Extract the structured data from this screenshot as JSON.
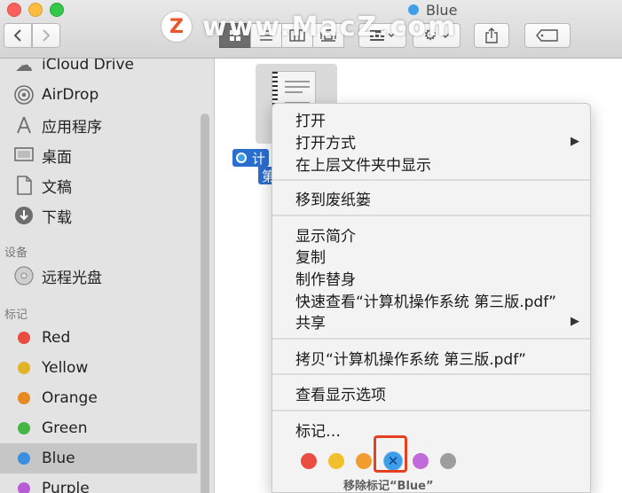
{
  "window": {
    "title": "Blue",
    "title_tag_color": "#3fa0ea"
  },
  "watermark": {
    "logo_letter": "Z",
    "text": "www.MacZ.com"
  },
  "toolbar": {
    "back_icon": "chevron-left-icon",
    "forward_icon": "chevron-right-icon",
    "views": [
      "icon-view",
      "list-view",
      "column-view",
      "cover-flow-view"
    ],
    "active_view": "icon-view",
    "arrange_icon": "arrange-grid-icon",
    "action_icon": "gear-icon",
    "share_icon": "share-icon",
    "tag_icon": "tag-icon"
  },
  "sidebar": {
    "favorites": [
      {
        "label": "iCloud Drive",
        "icon": "cloud-icon"
      },
      {
        "label": "AirDrop",
        "icon": "airdrop-icon"
      },
      {
        "label": "应用程序",
        "icon": "applications-icon"
      },
      {
        "label": "桌面",
        "icon": "desktop-icon"
      },
      {
        "label": "文稿",
        "icon": "documents-icon"
      },
      {
        "label": "下载",
        "icon": "downloads-icon"
      }
    ],
    "devices_header": "设备",
    "devices": [
      {
        "label": "远程光盘",
        "icon": "remote-disc-icon"
      }
    ],
    "tags_header": "标记",
    "tags": [
      {
        "label": "Red",
        "color": "#ea4c3f"
      },
      {
        "label": "Yellow",
        "color": "#e3b327"
      },
      {
        "label": "Orange",
        "color": "#e88a23"
      },
      {
        "label": "Green",
        "color": "#45b646"
      },
      {
        "label": "Blue",
        "color": "#3b8fe0",
        "selected": true
      },
      {
        "label": "Purple",
        "color": "#b85bd6"
      }
    ]
  },
  "content": {
    "file_label_line1": "计",
    "file_label_line2": "第"
  },
  "context_menu": {
    "group1": [
      "打开",
      "打开方式",
      "在上层文件夹中显示"
    ],
    "group2": [
      "移到废纸篓"
    ],
    "group3": [
      "显示简介",
      "复制",
      "制作替身",
      "快速查看“计算机操作系统 第三版.pdf”",
      "共享"
    ],
    "group4": [
      "拷贝“计算机操作系统 第三版.pdf”"
    ],
    "group5": [
      "查看显示选项"
    ],
    "tags_label": "标记…",
    "tag_colors": [
      "#ec4b42",
      "#f2c02c",
      "#f39c30",
      "#3a9ee8",
      "#c16ad9",
      "#9d9d9d"
    ],
    "current_tag_mark": "✕",
    "tag_hint": "移除标记“Blue”"
  }
}
